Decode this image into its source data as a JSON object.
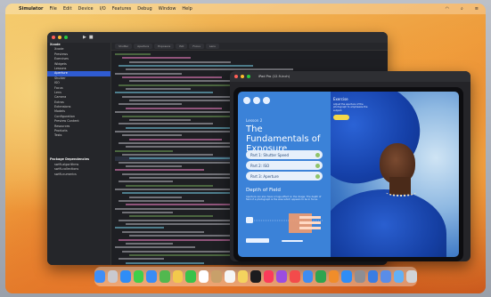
{
  "menubar": {
    "app": "Simulator",
    "items": [
      "File",
      "Edit",
      "Device",
      "I/O",
      "Features",
      "Debug",
      "Window",
      "Help"
    ]
  },
  "xcode": {
    "navigator": [
      {
        "label": "Xcode",
        "type": "hdr"
      },
      {
        "label": "Xcode",
        "type": "item"
      },
      {
        "label": "Previews",
        "type": "item"
      },
      {
        "label": "Exercises",
        "type": "item"
      },
      {
        "label": "Widgets",
        "type": "item"
      },
      {
        "label": "Lessons",
        "type": "item"
      },
      {
        "label": "Aperture",
        "type": "sel"
      },
      {
        "label": "Shutter",
        "type": "item"
      },
      {
        "label": "ISO",
        "type": "item"
      },
      {
        "label": "Focus",
        "type": "item"
      },
      {
        "label": "Lens",
        "type": "item"
      },
      {
        "label": "Camera",
        "type": "item"
      },
      {
        "label": "Extras",
        "type": "item"
      },
      {
        "label": "Extensions",
        "type": "item"
      },
      {
        "label": "Models",
        "type": "item"
      },
      {
        "label": "Configuration",
        "type": "item"
      },
      {
        "label": "Preview Content",
        "type": "item"
      },
      {
        "label": "Resources",
        "type": "item"
      },
      {
        "label": "Products",
        "type": "item"
      },
      {
        "label": "Tests",
        "type": "item"
      },
      {
        "label": "",
        "type": "item"
      },
      {
        "label": "",
        "type": "item"
      },
      {
        "label": "",
        "type": "item"
      },
      {
        "label": "",
        "type": "item"
      },
      {
        "label": "Package Dependencies",
        "type": "hdr"
      },
      {
        "label": "swift-algorithms",
        "type": "item"
      },
      {
        "label": "swift-collections",
        "type": "item"
      },
      {
        "label": "swift-numerics",
        "type": "item"
      }
    ],
    "tabs": [
      "Shutter",
      "Aperture",
      "Exposure",
      "ISO",
      "Focus",
      "Lens"
    ]
  },
  "preview": {
    "window_title": "iPad Pro (12.9-inch)",
    "lesson_label": "Lesson 2",
    "lesson_title": "The Fundamentals of Exposure",
    "parts": [
      "Part 1: Shutter Speed",
      "Part 2: ISO",
      "Part 3: Aperture"
    ],
    "section_title": "Depth of Field",
    "section_text": "Aperture can also have a huge effect on the image. The depth of field of a photograph is the area which appears to be in focus.",
    "exercise_title": "Exercise",
    "exercise_text": "Adjust the aperture of the photograph to emphasize the subject."
  },
  "dock": {
    "icons": [
      "finder-icon",
      "launchpad-icon",
      "safari-icon",
      "messages-icon",
      "mail-icon",
      "maps-icon",
      "photos-icon",
      "facetime-icon",
      "calendar-icon",
      "contacts-icon",
      "reminders-icon",
      "notes-icon",
      "tv-icon",
      "music-icon",
      "podcasts-icon",
      "news-icon",
      "keynote-icon",
      "numbers-icon",
      "pages-icon",
      "appstore-icon",
      "settings-icon",
      "xcode-icon",
      "simulator-icon",
      "folder-icon",
      "trash-icon"
    ],
    "colors": [
      "#3e8ef7",
      "#c9c9cf",
      "#2f8df6",
      "#3ecf4a",
      "#3a8cf5",
      "#52b84f",
      "#f2c94c",
      "#38c24a",
      "#ffffff",
      "#c8a06a",
      "#f5f5f5",
      "#f4d35e",
      "#1c1c1e",
      "#fb3b5a",
      "#9b4de0",
      "#f34b4b",
      "#3f8cf0",
      "#2ea44f",
      "#f08d2a",
      "#2f8df6",
      "#8e8e93",
      "#3b7de3",
      "#5a8de8",
      "#62b0f5",
      "#d0d4d8"
    ]
  }
}
